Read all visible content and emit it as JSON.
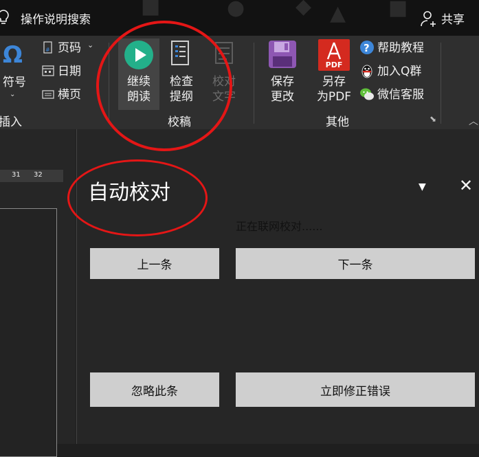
{
  "titlebar": {
    "search_label": "操作说明搜索",
    "share_label": "共享"
  },
  "ribbon": {
    "insert": {
      "symbol_label": "符号",
      "page_number_label": "页码",
      "date_label": "日期",
      "landscape_label": "横页",
      "group_label": "插入"
    },
    "proofread": {
      "continue_read_label": [
        "继续",
        "朗读"
      ],
      "check_outline_label": [
        "检查",
        "提纲"
      ],
      "proof_text_label": [
        "校对",
        "文字"
      ],
      "group_label": "校稿"
    },
    "other": {
      "save_changes_label": [
        "保存",
        "更改"
      ],
      "save_as_pdf_label": [
        "另存",
        "为PDF"
      ],
      "pdf_badge": "PDF",
      "help_label": "帮助教程",
      "join_qq_label": "加入Q群",
      "wechat_label": "微信客服",
      "group_label": "其他"
    }
  },
  "ruler": {
    "ticks": [
      "31",
      "32"
    ]
  },
  "pane": {
    "title": "自动校对",
    "status": "正在联网校对......",
    "prev_button": "上一条",
    "next_button": "下一条",
    "ignore_button": "忽略此条",
    "fix_button": "立即修正错误"
  },
  "colors": {
    "accent_green": "#23b08a",
    "save_purple": "#8e57b3",
    "pdf_red": "#d42a1f",
    "help_blue": "#3d86d8",
    "annotation_red": "#e41616"
  }
}
